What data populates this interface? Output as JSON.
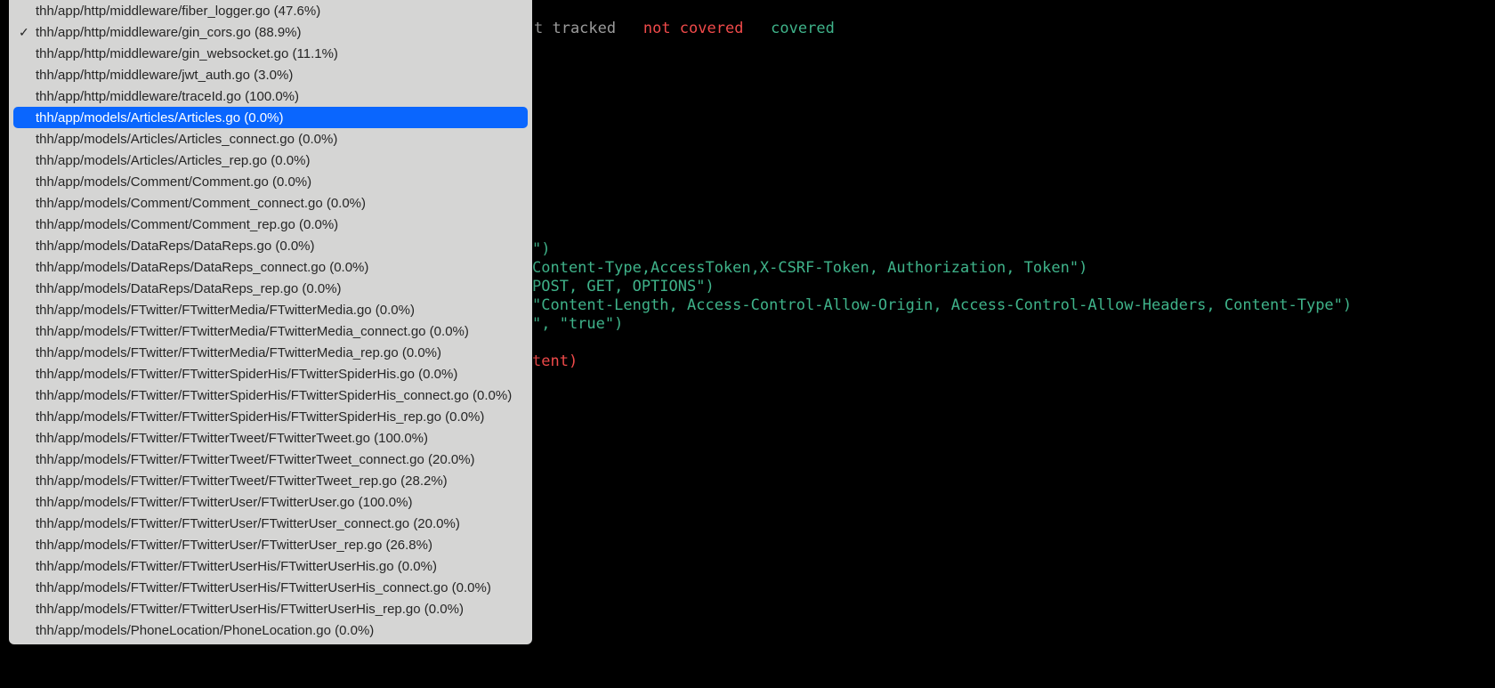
{
  "legend": {
    "tracked": "t tracked",
    "not_covered": "not covered",
    "covered": "covered"
  },
  "dropdown": {
    "checked_index": 1,
    "selected_index": 5,
    "items": [
      "thh/app/http/middleware/fiber_logger.go (47.6%)",
      "thh/app/http/middleware/gin_cors.go (88.9%)",
      "thh/app/http/middleware/gin_websocket.go (11.1%)",
      "thh/app/http/middleware/jwt_auth.go (3.0%)",
      "thh/app/http/middleware/traceId.go (100.0%)",
      "thh/app/models/Articles/Articles.go (0.0%)",
      "thh/app/models/Articles/Articles_connect.go (0.0%)",
      "thh/app/models/Articles/Articles_rep.go (0.0%)",
      "thh/app/models/Comment/Comment.go (0.0%)",
      "thh/app/models/Comment/Comment_connect.go (0.0%)",
      "thh/app/models/Comment/Comment_rep.go (0.0%)",
      "thh/app/models/DataReps/DataReps.go (0.0%)",
      "thh/app/models/DataReps/DataReps_connect.go (0.0%)",
      "thh/app/models/DataReps/DataReps_rep.go (0.0%)",
      "thh/app/models/FTwitter/FTwitterMedia/FTwitterMedia.go (0.0%)",
      "thh/app/models/FTwitter/FTwitterMedia/FTwitterMedia_connect.go (0.0%)",
      "thh/app/models/FTwitter/FTwitterMedia/FTwitterMedia_rep.go (0.0%)",
      "thh/app/models/FTwitter/FTwitterSpiderHis/FTwitterSpiderHis.go (0.0%)",
      "thh/app/models/FTwitter/FTwitterSpiderHis/FTwitterSpiderHis_connect.go (0.0%)",
      "thh/app/models/FTwitter/FTwitterSpiderHis/FTwitterSpiderHis_rep.go (0.0%)",
      "thh/app/models/FTwitter/FTwitterTweet/FTwitterTweet.go (100.0%)",
      "thh/app/models/FTwitter/FTwitterTweet/FTwitterTweet_connect.go (20.0%)",
      "thh/app/models/FTwitter/FTwitterTweet/FTwitterTweet_rep.go (28.2%)",
      "thh/app/models/FTwitter/FTwitterUser/FTwitterUser.go (100.0%)",
      "thh/app/models/FTwitter/FTwitterUser/FTwitterUser_connect.go (20.0%)",
      "thh/app/models/FTwitter/FTwitterUser/FTwitterUser_rep.go (26.8%)",
      "thh/app/models/FTwitter/FTwitterUserHis/FTwitterUserHis.go (0.0%)",
      "thh/app/models/FTwitter/FTwitterUserHis/FTwitterUserHis_connect.go (0.0%)",
      "thh/app/models/FTwitter/FTwitterUserHis/FTwitterUserHis_rep.go (0.0%)",
      "thh/app/models/PhoneLocation/PhoneLocation.go (0.0%)"
    ]
  },
  "code": {
    "lines": [
      {
        "cls": "g",
        "text": "\")"
      },
      {
        "cls": "g",
        "text": "Content-Type,AccessToken,X-CSRF-Token, Authorization, Token\")"
      },
      {
        "cls": "g",
        "text": "POST, GET, OPTIONS\")"
      },
      {
        "cls": "g",
        "text": "\"Content-Length, Access-Control-Allow-Origin, Access-Control-Allow-Headers, Content-Type\")"
      },
      {
        "cls": "g",
        "text": "\", \"true\")"
      },
      {
        "cls": "g",
        "text": ""
      },
      {
        "cls": "r",
        "text": "tent)"
      }
    ]
  }
}
